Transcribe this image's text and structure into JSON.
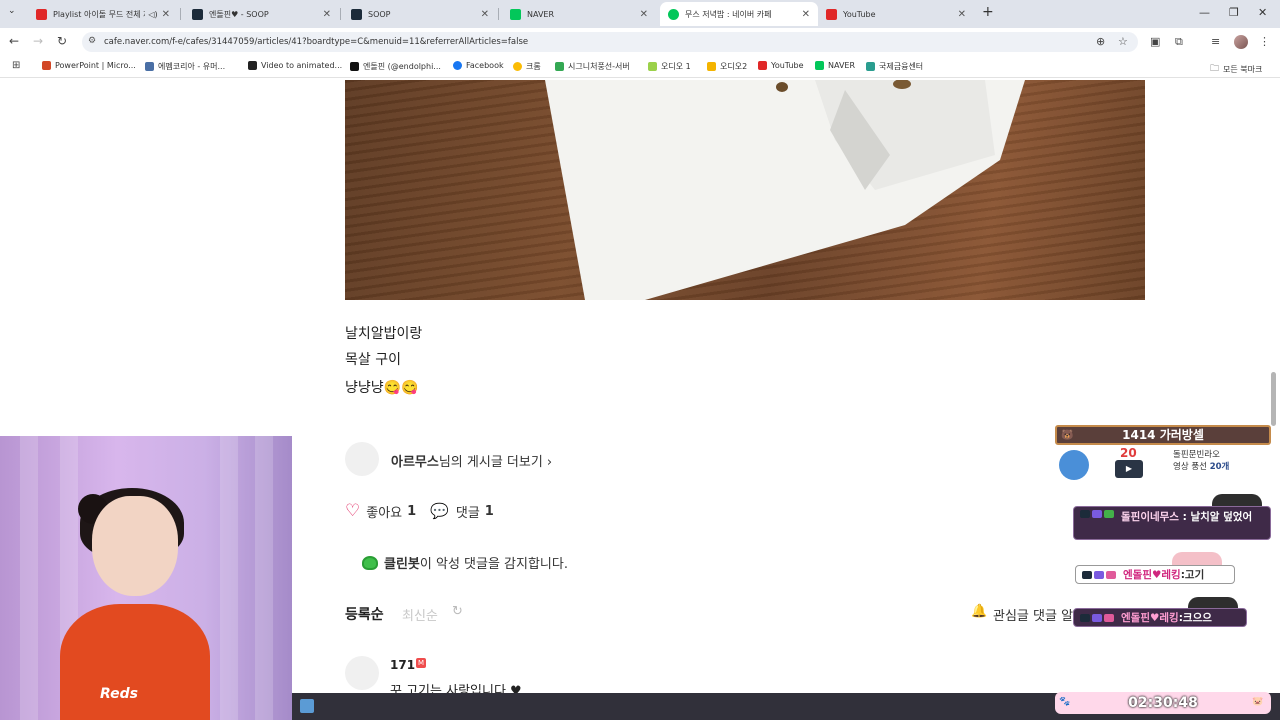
{
  "browser": {
    "tabs": [
      {
        "title": "Playlist 아이돌 무드 전체 재생",
        "favicon_color": "#e02828"
      },
      {
        "title": "엔돌핀♥ - SOOP",
        "favicon_color": "#1c2b3a"
      },
      {
        "title": "SOOP",
        "favicon_color": "#1c2b3a"
      },
      {
        "title": "NAVER",
        "favicon_color": "#03c75a"
      },
      {
        "title": "무스 저녁밥 : 네이버 카페",
        "favicon_color": "#03c75a",
        "active": true
      },
      {
        "title": "YouTube",
        "favicon_color": "#e02828"
      }
    ],
    "url": "cafe.naver.com/f-e/cafes/31447059/articles/41?boardtype=C&menuid=11&referrerAllArticles=false",
    "bookmarks": [
      {
        "label": "PowerPoint | Micro...",
        "icon_color": "#d24726"
      },
      {
        "label": "에펨코리아 - 유머...",
        "icon_color": "#4a6fa5"
      },
      {
        "label": "Video to animated...",
        "icon_color": "#222222"
      },
      {
        "label": "엔돌핀 (@endolphi...",
        "icon_color": "#111111"
      },
      {
        "label": "Facebook",
        "icon_color": "#1877f2"
      },
      {
        "label": "크롬",
        "icon_color": "#fbbc05"
      },
      {
        "label": "시그니처풍선-서버",
        "icon_color": "#34a853"
      },
      {
        "label": "오디오 1",
        "icon_color": "#9bd14a"
      },
      {
        "label": "오디오2",
        "icon_color": "#f4b400"
      },
      {
        "label": "YouTube",
        "icon_color": "#e02828"
      },
      {
        "label": "NAVER",
        "icon_color": "#03c75a"
      },
      {
        "label": "국제금융센터",
        "icon_color": "#2a9d8f"
      }
    ],
    "all_bookmarks_label": "모든 북마크"
  },
  "post": {
    "lines": [
      "날치알밥이랑",
      "목살 구이",
      "냥냥냥😋😋"
    ],
    "author_name": "아르무스",
    "author_more_suffix": "님의 게시글 더보기 ›",
    "like_label": "좋아요",
    "like_count": "1",
    "comment_label": "댓글",
    "comment_count": "1",
    "cleanbot_name": "클린봇",
    "cleanbot_text": "이 악성 댓글을 감지합니다.",
    "sort_registered": "등록순",
    "sort_newest": "최신순",
    "watch_label": "관심글 댓글 알림"
  },
  "comment": {
    "nickname": "171",
    "badge": "M",
    "text": "꾸 고기는 사랑입니다 ♥"
  },
  "overlay": {
    "rank_text": "1414 가러방셀",
    "promo_number": "20",
    "promo_line1": "돌핀문빈라오",
    "promo_line2_prefix": "영상 풍선 ",
    "promo_line2_value": "20개",
    "chats": [
      {
        "name": "돌핀이네무스",
        "sep": " : ",
        "msg": "날치알 덮었어"
      },
      {
        "name": "엔돌핀♥레킹",
        "sep": " : ",
        "msg": "고기"
      },
      {
        "name": "엔돌핀♥레킹",
        "sep": " : ",
        "msg": "크으으"
      }
    ],
    "shirt_text": "Reds",
    "timer": "02:30:48"
  }
}
